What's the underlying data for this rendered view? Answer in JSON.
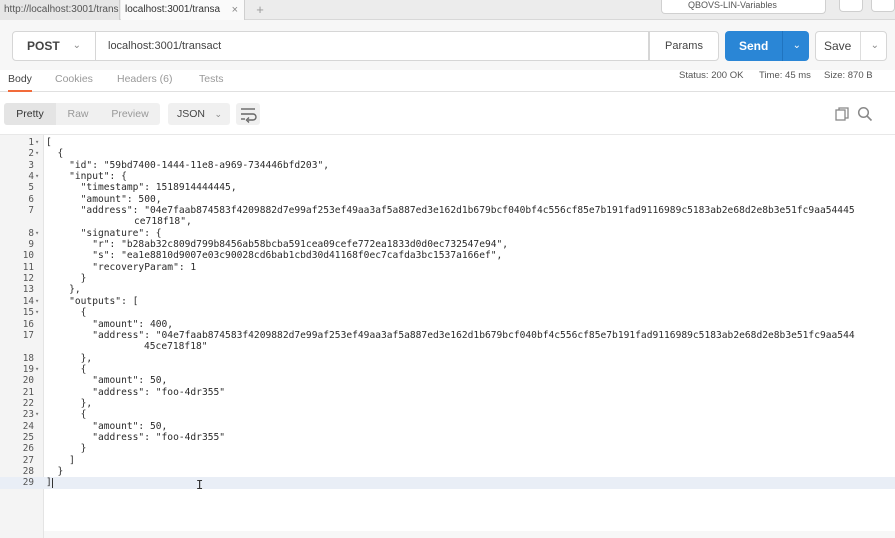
{
  "browser_tabs": [
    {
      "label": "http://localhost:3001/transa"
    },
    {
      "label": "localhost:3001/transa",
      "close": "×"
    }
  ],
  "new_tab_label": "+",
  "environment": {
    "label": "QBOVS-LIN-Variables"
  },
  "request": {
    "method": "POST",
    "url": "localhost:3001/transact",
    "params_label": "Params",
    "send_label": "Send",
    "save_label": "Save"
  },
  "response_tabs": [
    {
      "label": "Body",
      "active": true
    },
    {
      "label": "Cookies",
      "active": false
    },
    {
      "label": "Headers (6)",
      "active": false
    },
    {
      "label": "Tests",
      "active": false
    }
  ],
  "status": {
    "status": "Status: 200 OK",
    "time": "Time: 45 ms",
    "size": "Size: 870 B"
  },
  "view_modes": {
    "pretty": "Pretty",
    "raw": "Raw",
    "preview": "Preview"
  },
  "format": "JSON",
  "icons": {
    "method_dropdown": "chevron-down-icon",
    "send_dropdown": "chevron-down-icon",
    "save_dropdown": "chevron-down-icon",
    "format_dropdown": "chevron-down-icon",
    "wrap": "wrap-lines-icon",
    "copy": "copy-icon",
    "search": "search-icon",
    "fold": "fold-arrow-icon"
  },
  "colors": {
    "send": "#2a86d6",
    "active_tab_underline": "#f26b3a",
    "gutter": "#f4f4f4"
  },
  "code_lines": [
    {
      "n": "1",
      "fold": true,
      "text": "["
    },
    {
      "n": "2",
      "fold": true,
      "text": "  {"
    },
    {
      "n": "3",
      "fold": false,
      "text": "    \"id\": \"59bd7400-1444-11e8-a969-734446bfd203\","
    },
    {
      "n": "4",
      "fold": true,
      "text": "    \"input\": {"
    },
    {
      "n": "5",
      "fold": false,
      "text": "      \"timestamp\": 1518914444445,"
    },
    {
      "n": "6",
      "fold": false,
      "text": "      \"amount\": 500,"
    },
    {
      "n": "7",
      "fold": false,
      "text": "      \"address\": \"04e7faab874583f4209882d7e99af253ef49aa3af5a887ed3e162d1b679bcf040bf4c556cf85e7b191fad9116989c5183ab2e68d2e8b3e51fc9aa54445"
    },
    {
      "n": "",
      "fold": false,
      "cont": true,
      "text": "ce718f18\","
    },
    {
      "n": "8",
      "fold": true,
      "text": "      \"signature\": {"
    },
    {
      "n": "9",
      "fold": false,
      "text": "        \"r\": \"b28ab32c809d799b8456ab58bcba591cea09cefe772ea1833d0d0ec732547e94\","
    },
    {
      "n": "10",
      "fold": false,
      "text": "        \"s\": \"ea1e8810d9007e03c90028cd6bab1cbd30d41168f0ec7cafda3bc1537a166ef\","
    },
    {
      "n": "11",
      "fold": false,
      "text": "        \"recoveryParam\": 1"
    },
    {
      "n": "12",
      "fold": false,
      "text": "      }"
    },
    {
      "n": "13",
      "fold": false,
      "text": "    },"
    },
    {
      "n": "14",
      "fold": true,
      "text": "    \"outputs\": ["
    },
    {
      "n": "15",
      "fold": true,
      "text": "      {"
    },
    {
      "n": "16",
      "fold": false,
      "text": "        \"amount\": 400,"
    },
    {
      "n": "17",
      "fold": false,
      "text": "        \"address\": \"04e7faab874583f4209882d7e99af253ef49aa3af5a887ed3e162d1b679bcf040bf4c556cf85e7b191fad9116989c5183ab2e68d2e8b3e51fc9aa544"
    },
    {
      "n": "",
      "fold": false,
      "cont2": true,
      "text": "45ce718f18\""
    },
    {
      "n": "18",
      "fold": false,
      "text": "      },"
    },
    {
      "n": "19",
      "fold": true,
      "text": "      {"
    },
    {
      "n": "20",
      "fold": false,
      "text": "        \"amount\": 50,"
    },
    {
      "n": "21",
      "fold": false,
      "text": "        \"address\": \"foo-4dr355\""
    },
    {
      "n": "22",
      "fold": false,
      "text": "      },"
    },
    {
      "n": "23",
      "fold": true,
      "text": "      {"
    },
    {
      "n": "24",
      "fold": false,
      "text": "        \"amount\": 50,"
    },
    {
      "n": "25",
      "fold": false,
      "text": "        \"address\": \"foo-4dr355\""
    },
    {
      "n": "26",
      "fold": false,
      "text": "      }"
    },
    {
      "n": "27",
      "fold": false,
      "text": "    ]"
    },
    {
      "n": "28",
      "fold": false,
      "text": "  }"
    },
    {
      "n": "29",
      "fold": false,
      "last": true,
      "text": "]"
    }
  ]
}
